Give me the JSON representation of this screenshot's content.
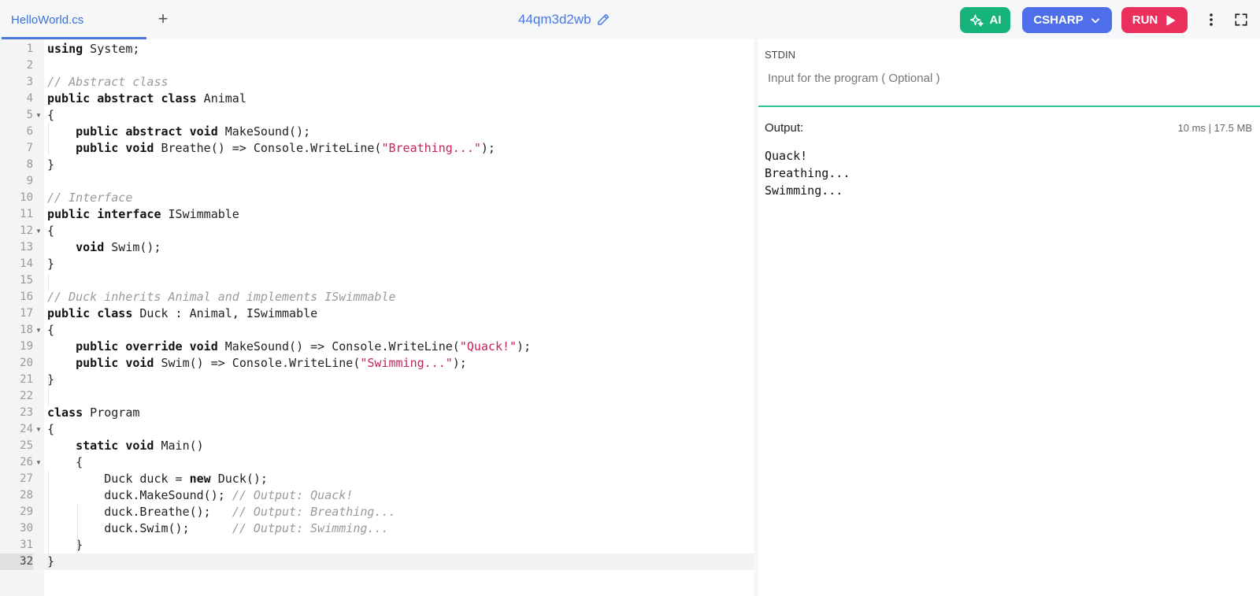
{
  "tab": {
    "filename": "HelloWorld.cs",
    "add_label": "+"
  },
  "project": {
    "name": "44qm3d2wb"
  },
  "toolbar": {
    "ai_label": "AI",
    "language_label": "CSHARP",
    "run_label": "RUN"
  },
  "colors": {
    "ai": "#16b47a",
    "language": "#4f6fea",
    "run": "#ea2f5c",
    "accent": "#4a78e0",
    "divider": "#2bc48a"
  },
  "editor": {
    "lines": [
      [
        {
          "t": "kw",
          "v": "using"
        },
        {
          "t": "",
          "v": " System;"
        }
      ],
      [],
      [
        {
          "t": "cm",
          "v": "// Abstract class"
        }
      ],
      [
        {
          "t": "kw",
          "v": "public abstract class"
        },
        {
          "t": "",
          "v": " Animal"
        }
      ],
      [
        {
          "t": "",
          "v": "{"
        }
      ],
      [
        {
          "t": "",
          "v": "    "
        },
        {
          "t": "kw",
          "v": "public abstract void"
        },
        {
          "t": "",
          "v": " MakeSound();"
        }
      ],
      [
        {
          "t": "",
          "v": "    "
        },
        {
          "t": "kw",
          "v": "public void"
        },
        {
          "t": "",
          "v": " Breathe() => Console.WriteLine("
        },
        {
          "t": "st",
          "v": "\"Breathing...\""
        },
        {
          "t": "",
          "v": ");"
        }
      ],
      [
        {
          "t": "",
          "v": "}"
        }
      ],
      [],
      [
        {
          "t": "cm",
          "v": "// Interface"
        }
      ],
      [
        {
          "t": "kw",
          "v": "public interface"
        },
        {
          "t": "",
          "v": " ISwimmable"
        }
      ],
      [
        {
          "t": "",
          "v": "{"
        }
      ],
      [
        {
          "t": "",
          "v": "    "
        },
        {
          "t": "kw",
          "v": "void"
        },
        {
          "t": "",
          "v": " Swim();"
        }
      ],
      [
        {
          "t": "",
          "v": "}"
        }
      ],
      [],
      [
        {
          "t": "cm",
          "v": "// Duck inherits Animal and implements ISwimmable"
        }
      ],
      [
        {
          "t": "kw",
          "v": "public class"
        },
        {
          "t": "",
          "v": " Duck : Animal, ISwimmable"
        }
      ],
      [
        {
          "t": "",
          "v": "{"
        }
      ],
      [
        {
          "t": "",
          "v": "    "
        },
        {
          "t": "kw",
          "v": "public override void"
        },
        {
          "t": "",
          "v": " MakeSound() => Console.WriteLine("
        },
        {
          "t": "st",
          "v": "\"Quack!\""
        },
        {
          "t": "",
          "v": ");"
        }
      ],
      [
        {
          "t": "",
          "v": "    "
        },
        {
          "t": "kw",
          "v": "public void"
        },
        {
          "t": "",
          "v": " Swim() => Console.WriteLine("
        },
        {
          "t": "st",
          "v": "\"Swimming...\""
        },
        {
          "t": "",
          "v": ");"
        }
      ],
      [
        {
          "t": "",
          "v": "}"
        }
      ],
      [],
      [
        {
          "t": "kw",
          "v": "class"
        },
        {
          "t": "",
          "v": " Program"
        }
      ],
      [
        {
          "t": "",
          "v": "{"
        }
      ],
      [
        {
          "t": "",
          "v": "    "
        },
        {
          "t": "kw",
          "v": "static void"
        },
        {
          "t": "",
          "v": " Main()"
        }
      ],
      [
        {
          "t": "",
          "v": "    {"
        }
      ],
      [
        {
          "t": "",
          "v": "        Duck duck = "
        },
        {
          "t": "kw",
          "v": "new"
        },
        {
          "t": "",
          "v": " Duck();"
        }
      ],
      [
        {
          "t": "",
          "v": "        duck.MakeSound(); "
        },
        {
          "t": "cm",
          "v": "// Output: Quack!"
        }
      ],
      [
        {
          "t": "",
          "v": "        duck.Breathe();   "
        },
        {
          "t": "cm",
          "v": "// Output: Breathing..."
        }
      ],
      [
        {
          "t": "",
          "v": "        duck.Swim();      "
        },
        {
          "t": "cm",
          "v": "// Output: Swimming..."
        }
      ],
      [
        {
          "t": "",
          "v": "    }"
        }
      ],
      [
        {
          "t": "",
          "v": "}"
        }
      ]
    ],
    "fold_lines": [
      5,
      12,
      18,
      24,
      26
    ],
    "active_line": 32
  },
  "stdin": {
    "label": "STDIN",
    "placeholder": "Input for the program ( Optional )"
  },
  "output": {
    "label": "Output:",
    "stats": "10 ms | 17.5 MB",
    "text": "Quack!\nBreathing...\nSwimming..."
  }
}
